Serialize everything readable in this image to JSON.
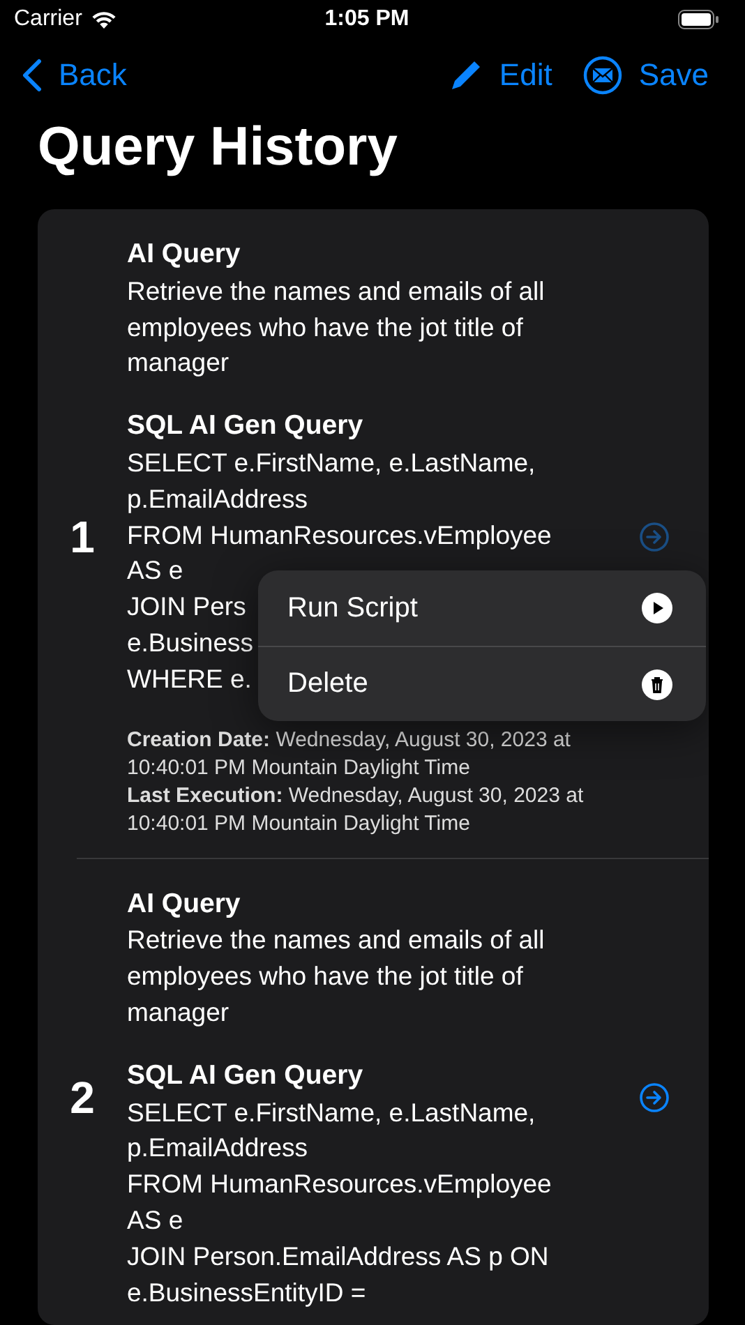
{
  "status_bar": {
    "carrier": "Carrier",
    "time": "1:05 PM"
  },
  "nav_bar": {
    "back": "Back",
    "edit": "Edit",
    "save": "Save"
  },
  "title": "Query History",
  "queries": [
    {
      "number": "1",
      "ai_label": "AI Query",
      "ai_query": "Retrieve the names and emails of all employees who have the jot title of manager",
      "sql_label": "SQL AI Gen Query",
      "sql_lines": [
        "SELECT e.FirstName, e.LastName,",
        "p.EmailAddress",
        "FROM HumanResources.vEmployee",
        "AS e",
        "JOIN Pers",
        "e.Business",
        "WHERE e."
      ],
      "dates": [
        "**Creation Date:** Wednesday, August 30, 2023 at 10:40:01 PM Mountain Daylight Time",
        "**Last Execution:** Wednesday, August 30, 2023 at 10:40:01 PM Mountain Daylight Time"
      ]
    },
    {
      "number": "2",
      "ai_label": "AI Query",
      "ai_query": "Retrieve the names and emails of all employees who have the jot title of manager",
      "sql_label": "SQL AI Gen Query",
      "sql_lines": [
        "SELECT e.FirstName, e.LastName,",
        "p.EmailAddress",
        "FROM HumanResources.vEmployee",
        "AS e",
        "JOIN Person.EmailAddress AS p ON",
        "e.BusinessEntityID ="
      ]
    }
  ],
  "context_menu": {
    "items": [
      {
        "label": "Run Script"
      },
      {
        "label": "Delete"
      }
    ]
  }
}
